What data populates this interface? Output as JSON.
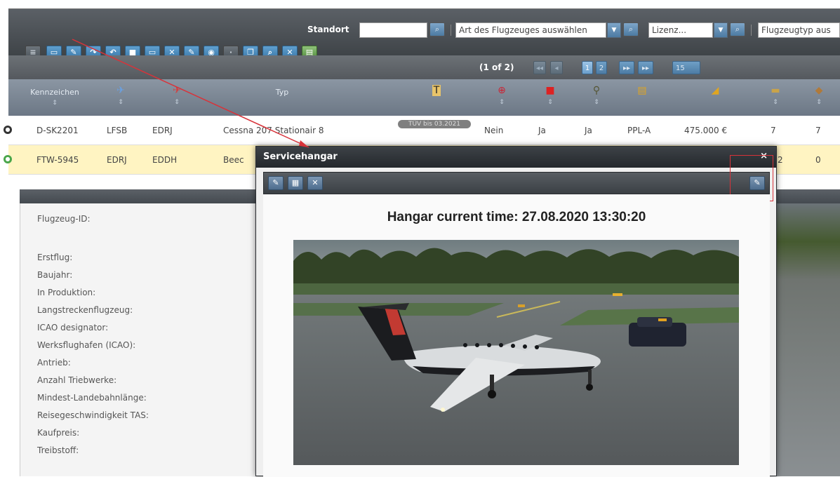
{
  "toolbar": {
    "standort_label": "Standort",
    "standort_value": "",
    "aircraft_type_select": "Art des Flugzeuges auswählen",
    "license_select": "Lizenz...",
    "plane_type_select": "Flugzeugtyp aus"
  },
  "pager": {
    "status": "(1 of 2)",
    "pages": [
      "1",
      "2"
    ],
    "per_page": "15"
  },
  "table": {
    "headers": {
      "registration": "Kennzeichen",
      "type": "Typ"
    },
    "rows": [
      {
        "registration": "D-SK2201",
        "from": "LFSB",
        "to": "EDRJ",
        "type": "Cessna 207 Stationair 8",
        "status": "TÜV bis 03.2021",
        "col_a": "Nein",
        "col_b": "Ja",
        "col_c": "Ja",
        "license": "PPL-A",
        "price": "475.000 €",
        "n1": "7",
        "n2": "7"
      },
      {
        "registration": "FTW-5945",
        "from": "EDRJ",
        "to": "EDDH",
        "type": "Beec",
        "n1": "2",
        "n2": "0"
      }
    ]
  },
  "details": {
    "fields": [
      "Flugzeug-ID:",
      "Erstflug:",
      "Baujahr:",
      "In Produktion:",
      "Langstreckenflugzeug:",
      "ICAO designator:",
      "Werksflughafen (ICAO):",
      "Antrieb:",
      "Anzahl Triebwerke:",
      "Mindest-Landebahnlänge:",
      "Reisegeschwindigkeit TAS:",
      "Kaufpreis:",
      "Treibstoff:"
    ]
  },
  "modal": {
    "title": "Servicehangar",
    "close_glyph": "×",
    "hangar_time": "Hangar current time: 27.08.2020 13:30:20"
  },
  "colors": {
    "selected_row": "#fff4c2",
    "annotation": "#d8333a",
    "header_dark": "#3d4247"
  },
  "icons": {
    "toolbar": [
      "menu-icon",
      "grid-icon",
      "wrench-icon",
      "redo-icon",
      "undo-icon",
      "save-icon",
      "list-icon",
      "delete-icon",
      "tool-icon",
      "eye-icon",
      "copy-icon",
      "search-icon",
      "clear-icon",
      "excel-icon"
    ],
    "modal_toolbar": [
      "wrench-icon",
      "calculator-icon",
      "close-icon"
    ]
  }
}
